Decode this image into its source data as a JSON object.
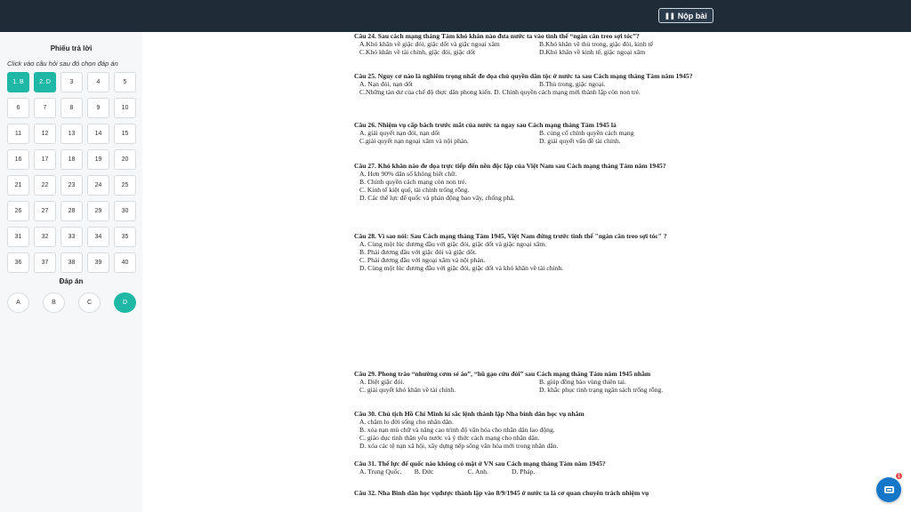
{
  "header": {
    "submit_label": "Nộp bài",
    "submit_icon": "pause-icon"
  },
  "sidebar": {
    "title": "Phiếu trả lời",
    "hint": "Click vào câu hỏi sau đó chọn đáp án",
    "questions": [
      {
        "label": "1. B",
        "answered": true
      },
      {
        "label": "2. D",
        "answered": true
      },
      {
        "label": "3"
      },
      {
        "label": "4"
      },
      {
        "label": "5"
      },
      {
        "label": "6"
      },
      {
        "label": "7"
      },
      {
        "label": "8"
      },
      {
        "label": "9"
      },
      {
        "label": "10"
      },
      {
        "label": "11"
      },
      {
        "label": "12"
      },
      {
        "label": "13"
      },
      {
        "label": "14"
      },
      {
        "label": "15"
      },
      {
        "label": "16"
      },
      {
        "label": "17"
      },
      {
        "label": "18"
      },
      {
        "label": "19"
      },
      {
        "label": "20"
      },
      {
        "label": "21"
      },
      {
        "label": "22"
      },
      {
        "label": "23"
      },
      {
        "label": "24"
      },
      {
        "label": "25"
      },
      {
        "label": "26"
      },
      {
        "label": "27"
      },
      {
        "label": "28"
      },
      {
        "label": "29"
      },
      {
        "label": "30"
      },
      {
        "label": "31"
      },
      {
        "label": "32"
      },
      {
        "label": "33"
      },
      {
        "label": "34"
      },
      {
        "label": "35"
      },
      {
        "label": "36"
      },
      {
        "label": "37"
      },
      {
        "label": "38"
      },
      {
        "label": "39"
      },
      {
        "label": "40"
      }
    ],
    "answers_title": "Đáp án",
    "answers": [
      "A",
      "B",
      "C",
      "D"
    ],
    "selected_answer": "D",
    "accent": "#1fb8a6"
  },
  "document": {
    "q24": {
      "text": "Câu  24. Sau cách mạng tháng Tám khó khăn nào đưa nước ta vào tình thế “ngàn cân treo sợi tóc”?",
      "a": "A.Khó khăn về giặc đói, giặc dốt và giặc ngoại xâm",
      "b": "B.Khó khăn về thù trong, giặc đói, kinh tế",
      "c": "C.Khó khăn về tài chính, giặc đói, giặc dốt",
      "d": "D.Khó khăn về kinh tế, giặc ngoại xâm"
    },
    "q25": {
      "text": "Câu 25.  Nguy cơ nào là nghiêm trọng nhất đe dọa chủ quyền dân tộc ở nước ta  sau Cách mạng tháng Tám năm 1945?",
      "a": "A. Nạn đói, nạn dốt",
      "b": "B.Thù trong, giặc ngoại.",
      "cd": "C.Những tàn dư của chế độ thực dân phong kiến. D. Chính quyền cách mạng mới thành lập còn non trẻ."
    },
    "q26": {
      "text": "Câu  26. Nhiệm vụ cấp bách trước mắt của nước ta ngay sau Cách mạng tháng Tám 1945 là",
      "a": "A. giải quyết nạn đói, nạn dốt",
      "b": "B. củng cố chính quyền cách mạng",
      "c": "C.giải quyết nạn ngoại xâm và nội phản.",
      "d": "D. giải quyết vấn đề tài chính."
    },
    "q27": {
      "text": "Câu  27.  Khó khăn nào đe dọa trực tiếp đến nền độc lập của Việt Nam sau Cách mạng tháng Tám năm 1945?",
      "a": "A. Hơn 90% dân số không biết chữ.",
      "b": "B. Chính quyền cách mạng còn non trẻ.",
      "c": "C. Kinh tế kiệt quệ, tài chính trống rỗng.",
      "d": "D. Các thế lực đế quốc và phản động bao vây, chống phá."
    },
    "q28": {
      "text": "Câu  28. Vì sao nói: Sau Cách mạng tháng Tám 1945, Việt Nam đứng trước tình thế \"ngàn cân treo sợi tóc\" ?",
      "a": "A. Cùng một lúc đương đầu với giặc đói, giặc dốt và giặc ngoại xâm.",
      "b": "B. Phải đương đầu với giặc đói và giặc dốt.",
      "c": "C. Phải đương đầu với ngoại xâm và nội phản.",
      "d": "D. Cùng một lúc đương đầu với giặc đói, giặc dốt và khó khăn về tài chính."
    },
    "q29": {
      "text": "Câu  29.  Phong trào “nhường cơm sẻ áo”, “hũ gạo cứu đói” sau Cách mạng tháng Tám năm 1945 nhằm",
      "a": "A. Diệt giặc đói.",
      "b": "B. giúp đồng bào vùng thiên tai.",
      "c": "C. giải quyết khó khăn về tài chính.",
      "d": "D. khắc phục tình trạng ngân sách trống rỗng."
    },
    "q30": {
      "text": "Câu 30. Chủ tịch Hồ Chí Minh kí sắc lệnh thành lập Nha bình dân học vụ nhằm",
      "a": "A. chăm lo đời sống cho nhân dân.",
      "b": "B. xóa nạn mù chữ và nâng cao trình độ văn hóa cho nhân dân lao động.",
      "c": "C. giáo dục tinh thần yêu nước và ý thức cách mạng cho nhân dân.",
      "d": "D. xóa các tệ nạn xã hội, xây dựng nếp sống văn hóa mới trong nhân dân."
    },
    "q31": {
      "text": "Câu 31.  Thế lực đế quốc nào không có mặt ở VN sau Cách mạng tháng Tám năm 1945?",
      "a": "A. Trung Quốc.",
      "b": "B. Đức",
      "c": "C. Anh.",
      "d": "D. Pháp."
    },
    "q32": {
      "text": "Câu 32. Nha Bình dân học vụđược thành lập vào 8/9/1945 ở nước ta là cơ quan chuyên trách nhiệm vụ"
    }
  },
  "chat": {
    "icon": "chat-icon",
    "badge": "1"
  }
}
